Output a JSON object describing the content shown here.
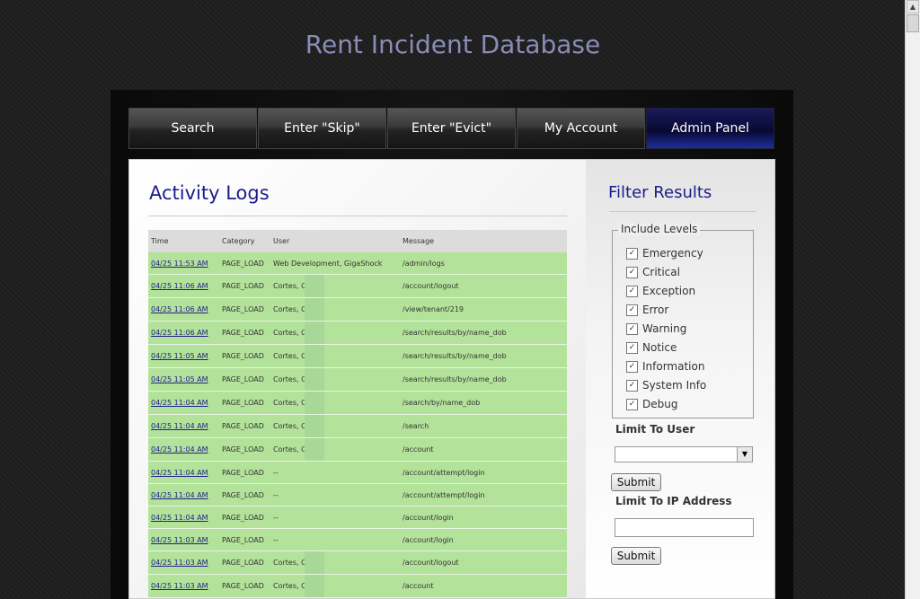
{
  "site_title": "Rent Incident Database",
  "nav": [
    {
      "label": "Search"
    },
    {
      "label": "Enter \"Skip\""
    },
    {
      "label": "Enter \"Evict\""
    },
    {
      "label": "My Account"
    },
    {
      "label": "Admin Panel"
    }
  ],
  "logs": {
    "title": "Activity Logs",
    "columns": [
      "Time",
      "Category",
      "User",
      "Message"
    ],
    "rows": [
      {
        "time": "04/25 11:53 AM",
        "category": "PAGE_LOAD",
        "user": "Web Development, GigaShock",
        "message": "/admin/logs"
      },
      {
        "time": "04/25 11:06 AM",
        "category": "PAGE_LOAD",
        "user": "Cortes, O",
        "message": "/account/logout"
      },
      {
        "time": "04/25 11:06 AM",
        "category": "PAGE_LOAD",
        "user": "Cortes, O",
        "message": "/view/tenant/219"
      },
      {
        "time": "04/25 11:06 AM",
        "category": "PAGE_LOAD",
        "user": "Cortes, O",
        "message": "/search/results/by/name_dob"
      },
      {
        "time": "04/25 11:05 AM",
        "category": "PAGE_LOAD",
        "user": "Cortes, O",
        "message": "/search/results/by/name_dob"
      },
      {
        "time": "04/25 11:05 AM",
        "category": "PAGE_LOAD",
        "user": "Cortes, O",
        "message": "/search/results/by/name_dob"
      },
      {
        "time": "04/25 11:04 AM",
        "category": "PAGE_LOAD",
        "user": "Cortes, O",
        "message": "/search/by/name_dob"
      },
      {
        "time": "04/25 11:04 AM",
        "category": "PAGE_LOAD",
        "user": "Cortes, O",
        "message": "/search"
      },
      {
        "time": "04/25 11:04 AM",
        "category": "PAGE_LOAD",
        "user": "Cortes, O",
        "message": "/account"
      },
      {
        "time": "04/25 11:04 AM",
        "category": "PAGE_LOAD",
        "user": "--",
        "message": "/account/attempt/login"
      },
      {
        "time": "04/25 11:04 AM",
        "category": "PAGE_LOAD",
        "user": "--",
        "message": "/account/attempt/login"
      },
      {
        "time": "04/25 11:04 AM",
        "category": "PAGE_LOAD",
        "user": "--",
        "message": "/account/login"
      },
      {
        "time": "04/25 11:03 AM",
        "category": "PAGE_LOAD",
        "user": "--",
        "message": "/account/login"
      },
      {
        "time": "04/25 11:03 AM",
        "category": "PAGE_LOAD",
        "user": "Cortes, O",
        "message": "/account/logout"
      },
      {
        "time": "04/25 11:03 AM",
        "category": "PAGE_LOAD",
        "user": "Cortes, O",
        "message": "/account"
      }
    ]
  },
  "filter": {
    "title": "Filter Results",
    "levels_legend": "Include Levels",
    "levels": [
      {
        "label": "Emergency",
        "checked": true
      },
      {
        "label": "Critical",
        "checked": true
      },
      {
        "label": "Exception",
        "checked": true
      },
      {
        "label": "Error",
        "checked": true
      },
      {
        "label": "Warning",
        "checked": true
      },
      {
        "label": "Notice",
        "checked": true
      },
      {
        "label": "Information",
        "checked": true
      },
      {
        "label": "System Info",
        "checked": true
      },
      {
        "label": "Debug",
        "checked": true
      }
    ],
    "limit_user_label": "Limit To User",
    "limit_user_value": "",
    "submit_label": "Submit",
    "limit_ip_label": "Limit To IP Address",
    "limit_ip_value": "",
    "submit_label_2": "Submit"
  }
}
